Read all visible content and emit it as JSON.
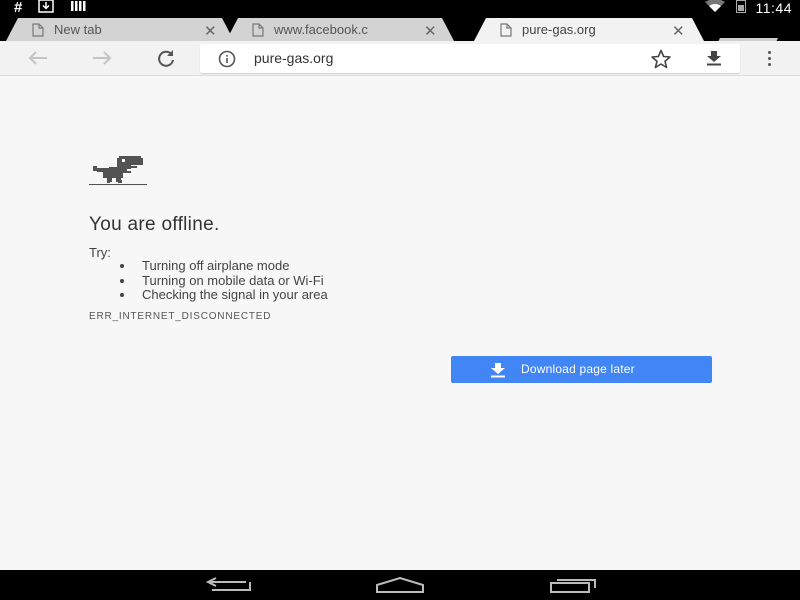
{
  "status_bar": {
    "hash_symbol": "#",
    "time": "11:44",
    "icons": [
      "download-notification-icon",
      "signal-bars-icon",
      "wifi-icon",
      "battery-icon"
    ]
  },
  "tabs": [
    {
      "title": "New tab",
      "active": false
    },
    {
      "title": "www.facebook.c",
      "active": false
    },
    {
      "title": "pure-gas.org",
      "active": true
    }
  ],
  "toolbar": {
    "url": "pure-gas.org"
  },
  "error_page": {
    "headline": "You are offline.",
    "try_label": "Try:",
    "suggestions": [
      "Turning off airplane mode",
      "Turning on mobile data or Wi-Fi",
      "Checking the signal in your area"
    ],
    "error_code": "ERR_INTERNET_DISCONNECTED",
    "download_button_label": "Download page later"
  },
  "colors": {
    "accent": "#4285f4",
    "page_background": "#f7f7f7",
    "toolbar_background": "#f2f2f2",
    "inactive_tab": "#d3d3d3"
  }
}
